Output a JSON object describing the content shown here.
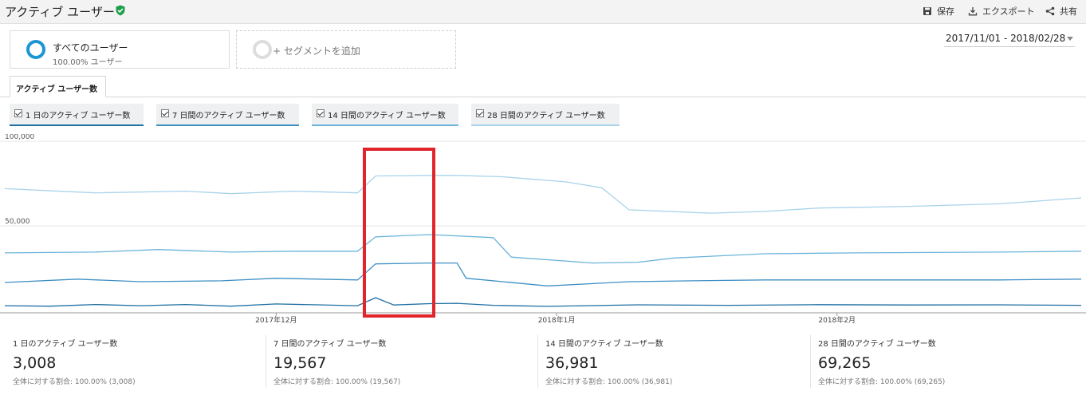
{
  "header": {
    "title": "アクティブ ユーザー",
    "actions": {
      "save": "保存",
      "export": "エクスポート",
      "share": "共有"
    }
  },
  "segments": {
    "primary": {
      "name": "すべてのユーザー",
      "percent": "100.00% ユーザー"
    },
    "add": "+ セグメントを追加"
  },
  "date_range": "2017/11/01 - 2018/02/28",
  "tab": {
    "label": "アクティブ ユーザー数"
  },
  "metrics": [
    {
      "label": "1 日のアクティブ ユーザー数",
      "color": "#1f6fa3"
    },
    {
      "label": "7 日間のアクティブ ユーザー数",
      "color": "#3e8fc4"
    },
    {
      "label": "14 日間のアクティブ ユーザー数",
      "color": "#6bb4d9"
    },
    {
      "label": "28 日間のアクティブ ユーザー数",
      "color": "#a9d3ea"
    }
  ],
  "stats": [
    {
      "label": "1 日のアクティブ ユーザー数",
      "value": "3,008",
      "share": "全体に対する割合: 100.00% (3,008)"
    },
    {
      "label": "7 日間のアクティブ ユーザー数",
      "value": "19,567",
      "share": "全体に対する割合: 100.00% (19,567)"
    },
    {
      "label": "14 日間のアクティブ ユーザー数",
      "value": "36,981",
      "share": "全体に対する割合: 100.00% (36,981)"
    },
    {
      "label": "28 日間のアクティブ ユーザー数",
      "value": "69,265",
      "share": "全体に対する割合: 100.00% (69,265)"
    }
  ],
  "highlight_color": "#e0262b",
  "chart_data": {
    "type": "line",
    "ylim": [
      0,
      100000
    ],
    "y_ticks": [
      {
        "value": 100000,
        "label": "100,000"
      },
      {
        "value": 50000,
        "label": "50,000"
      }
    ],
    "x_ticks": [
      {
        "day": 30,
        "label": "2017年12月"
      },
      {
        "day": 61,
        "label": "2018年1月"
      },
      {
        "day": 92,
        "label": "2018年2月"
      }
    ],
    "x_range": [
      0,
      119
    ],
    "grid": true,
    "legend": "none",
    "series": [
      {
        "name": "28 日間のアクティブ ユーザー数",
        "color": "#a9d3ea",
        "points": [
          [
            0,
            72000
          ],
          [
            10,
            69500
          ],
          [
            20,
            70500
          ],
          [
            25,
            69000
          ],
          [
            32,
            70500
          ],
          [
            39,
            69500
          ],
          [
            41,
            79500
          ],
          [
            47,
            79800
          ],
          [
            50,
            79800
          ],
          [
            55,
            79000
          ],
          [
            62,
            76000
          ],
          [
            66,
            72500
          ],
          [
            69,
            59500
          ],
          [
            78,
            57500
          ],
          [
            84,
            58500
          ],
          [
            90,
            60500
          ],
          [
            100,
            61500
          ],
          [
            110,
            63000
          ],
          [
            119,
            66500
          ]
        ]
      },
      {
        "name": "14 日間のアクティブ ユーザー数",
        "color": "#6bb4d9",
        "points": [
          [
            0,
            34000
          ],
          [
            10,
            34500
          ],
          [
            17,
            36000
          ],
          [
            25,
            34500
          ],
          [
            32,
            35000
          ],
          [
            39,
            35000
          ],
          [
            41,
            43500
          ],
          [
            47,
            44800
          ],
          [
            54,
            43000
          ],
          [
            56,
            31500
          ],
          [
            65,
            28000
          ],
          [
            70,
            28500
          ],
          [
            74,
            31000
          ],
          [
            84,
            33500
          ],
          [
            94,
            34000
          ],
          [
            110,
            34500
          ],
          [
            119,
            35000
          ]
        ]
      },
      {
        "name": "7 日間のアクティブ ユーザー数",
        "color": "#3e8fc4",
        "points": [
          [
            0,
            16500
          ],
          [
            8,
            18500
          ],
          [
            15,
            17000
          ],
          [
            24,
            17500
          ],
          [
            30,
            19000
          ],
          [
            39,
            18000
          ],
          [
            41,
            27500
          ],
          [
            47,
            28000
          ],
          [
            50,
            28000
          ],
          [
            51,
            19000
          ],
          [
            60,
            14500
          ],
          [
            69,
            17000
          ],
          [
            76,
            17500
          ],
          [
            84,
            18000
          ],
          [
            94,
            18000
          ],
          [
            110,
            18000
          ],
          [
            119,
            18500
          ]
        ]
      },
      {
        "name": "1 日のアクティブ ユーザー数",
        "color": "#1f6fa3",
        "points": [
          [
            0,
            2800
          ],
          [
            5,
            2500
          ],
          [
            10,
            3500
          ],
          [
            15,
            2800
          ],
          [
            20,
            3500
          ],
          [
            25,
            2500
          ],
          [
            30,
            3800
          ],
          [
            39,
            2800
          ],
          [
            41,
            7500
          ],
          [
            43,
            3200
          ],
          [
            47,
            4000
          ],
          [
            50,
            4200
          ],
          [
            54,
            3000
          ],
          [
            60,
            2400
          ],
          [
            70,
            3300
          ],
          [
            80,
            3000
          ],
          [
            90,
            3400
          ],
          [
            100,
            3200
          ],
          [
            110,
            3300
          ],
          [
            119,
            3000
          ]
        ]
      }
    ]
  }
}
